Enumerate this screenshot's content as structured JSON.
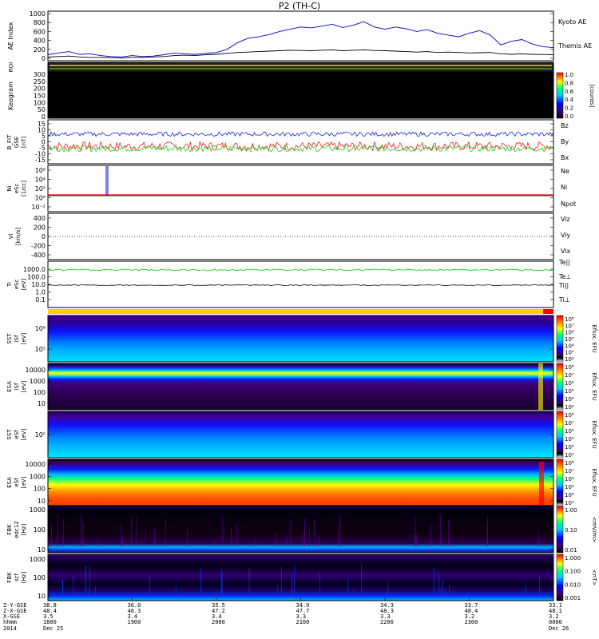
{
  "title": "P2 (TH-C)",
  "colors": {
    "red": "#ff0000",
    "green": "#00cc00",
    "blue": "#0000cc",
    "black": "#000000"
  },
  "chart_data": [
    {
      "type": "line",
      "panel": "ae",
      "ylabel": "AE Index",
      "ylim": [
        0,
        1000
      ],
      "yticks": [
        "1000",
        "800",
        "600",
        "400",
        "200",
        "0"
      ],
      "series": [
        {
          "name": "Kyoto AE",
          "color": "#0000cc",
          "values": [
            80,
            120,
            150,
            90,
            100,
            60,
            40,
            30,
            60,
            40,
            50,
            80,
            120,
            100,
            90,
            110,
            130,
            200,
            350,
            450,
            480,
            530,
            600,
            650,
            700,
            680,
            720,
            760,
            690,
            740,
            820,
            700,
            650,
            700,
            660,
            600,
            640,
            560,
            520,
            480,
            560,
            620,
            520,
            300,
            380,
            420,
            320,
            260,
            240
          ]
        },
        {
          "name": "Themis AE",
          "color": "#000000",
          "values": [
            30,
            40,
            50,
            30,
            20,
            20,
            15,
            10,
            20,
            20,
            30,
            40,
            60,
            70,
            60,
            80,
            90,
            110,
            130,
            140,
            150,
            160,
            170,
            180,
            175,
            170,
            180,
            190,
            170,
            180,
            190,
            175,
            170,
            160,
            150,
            140,
            150,
            130,
            140,
            130,
            120,
            125,
            130,
            100,
            90,
            100,
            90,
            85,
            80
          ]
        }
      ]
    },
    {
      "type": "heatmap",
      "panel": "roi",
      "ylabel": "ROI"
    },
    {
      "type": "heatmap",
      "panel": "keogram",
      "ylabel": "Keogram",
      "yticks": [
        "300",
        "250",
        "200",
        "150",
        "100",
        "50",
        "0"
      ],
      "colorbar": {
        "label": "[counts]",
        "ticks": [
          "1.0",
          "0.8",
          "0.6",
          "0.4",
          "0.2",
          "0.0"
        ]
      }
    },
    {
      "type": "line",
      "panel": "bfield",
      "ylabel": "B_FIT",
      "ylabel2": "GSE",
      "unit": "[nT]",
      "ylim": [
        -20,
        20
      ],
      "yticks": [
        "15",
        "10",
        "5",
        "0",
        "-5",
        "-10",
        "-15"
      ],
      "series": [
        {
          "name": "Bz",
          "color": "#ff0000"
        },
        {
          "name": "By",
          "color": "#00cc00"
        },
        {
          "name": "Bx",
          "color": "#0000cc"
        }
      ]
    },
    {
      "type": "line",
      "panel": "density",
      "ylabel": "Ni",
      "ylabel2": "eSc",
      "unit": "[1/cc]",
      "yticks": [
        "10⁶",
        "10⁴",
        "10²",
        "10⁰",
        "10⁻²"
      ],
      "series": [
        {
          "name": "Ne",
          "color": "#ff0000"
        },
        {
          "name": "Ni",
          "color": "#000000"
        },
        {
          "name": "Npot",
          "color": "#0000cc"
        }
      ]
    },
    {
      "type": "line",
      "panel": "velocity",
      "ylabel": "Vi",
      "unit": "[km/s]",
      "ylim": [
        -500,
        500
      ],
      "yticks": [
        "400",
        "200",
        "0",
        "-200",
        "-400"
      ],
      "series": [
        {
          "name": "Viz",
          "color": "#ff0000"
        },
        {
          "name": "Viy",
          "color": "#00cc00"
        },
        {
          "name": "Vix",
          "color": "#0000cc"
        }
      ]
    },
    {
      "type": "line",
      "panel": "temperature",
      "ylabel": "Ti",
      "ylabel2": "eSc",
      "unit": "[eV]",
      "yticks": [
        "1000.0",
        "100.0",
        "10.0",
        "1.0",
        "0.1"
      ],
      "series": [
        {
          "name": "Te||",
          "color": "#000000"
        },
        {
          "name": "Te⊥",
          "color": "#ff0000"
        },
        {
          "name": "Ti||",
          "color": "#00cc00"
        },
        {
          "name": "Ti⊥",
          "color": "#0000cc"
        }
      ]
    },
    {
      "type": "heatmap",
      "panel": "sst_i",
      "ylabel": "SST",
      "ylabel2": "iSf",
      "unit": "[eV]",
      "yticks": [
        "10⁶",
        "10⁵"
      ],
      "colorbar": {
        "label": "Eflux, EFU",
        "ticks": [
          "10⁸",
          "10⁷",
          "10⁶",
          "10⁵",
          "10⁴",
          "10³",
          "10²"
        ]
      }
    },
    {
      "type": "heatmap",
      "panel": "esa_i",
      "ylabel": "ESA",
      "ylabel2": "iSf",
      "unit": "[eV]",
      "yticks": [
        "10000",
        "1000",
        "100",
        "10"
      ],
      "colorbar": {
        "label": "Eflux, EFU",
        "ticks": [
          "10⁸",
          "10⁷",
          "10⁶",
          "10⁵",
          "10⁴",
          "10³"
        ]
      }
    },
    {
      "type": "heatmap",
      "panel": "sst_e",
      "ylabel": "SST",
      "ylabel2": "eSf",
      "unit": "[eV]",
      "yticks": [
        "10⁵"
      ],
      "colorbar": {
        "label": "Eflux, EFU",
        "ticks": [
          "10⁸",
          "10⁷",
          "10⁶",
          "10⁵",
          "10⁴",
          "10³"
        ]
      }
    },
    {
      "type": "heatmap",
      "panel": "esa_e",
      "ylabel": "ESA",
      "ylabel2": "eSf",
      "unit": "[eV]",
      "yticks": [
        "10000",
        "1000",
        "100",
        "10"
      ],
      "colorbar": {
        "label": "Eflux, EFU",
        "ticks": [
          "10⁸",
          "10⁷",
          "10⁶",
          "10⁵",
          "10⁴",
          "10³"
        ]
      }
    },
    {
      "type": "heatmap",
      "panel": "fbk_e",
      "ylabel": "FBK",
      "ylabel2": "edc12",
      "unit": "[Hz]",
      "yticks": [
        "1000",
        "100",
        "10"
      ],
      "colorbar": {
        "label": "<mV/m>",
        "ticks": [
          "1.00",
          "0.10",
          "0.01"
        ]
      }
    },
    {
      "type": "heatmap",
      "panel": "fbk_b",
      "ylabel": "FBK",
      "ylabel2": "scf",
      "unit": "[Hz]",
      "yticks": [
        "1000",
        "100",
        "10"
      ],
      "colorbar": {
        "label": "<nT>",
        "ticks": [
          "1.000",
          "0.100",
          "0.010",
          "0.001"
        ]
      }
    }
  ],
  "xaxis": {
    "row_labels": [
      "Z-Y-GSE",
      "Z-X-GSE",
      "X-GSE",
      "hhmm",
      "2014"
    ],
    "columns": [
      [
        "38.8",
        "48.4",
        "3.5",
        "1800",
        "Dec 25"
      ],
      [
        "36.0",
        "46.3",
        "3.4",
        "1900",
        ""
      ],
      [
        "35.5",
        "47.2",
        "3.4",
        "2000",
        ""
      ],
      [
        "34.9",
        "47.7",
        "3.3",
        "2100",
        ""
      ],
      [
        "34.3",
        "48.3",
        "3.3",
        "2200",
        ""
      ],
      [
        "33.7",
        "48.4",
        "3.2",
        "2300",
        ""
      ],
      [
        "33.1",
        "48.1",
        "3.2",
        "0000",
        "Dec 26"
      ]
    ]
  }
}
